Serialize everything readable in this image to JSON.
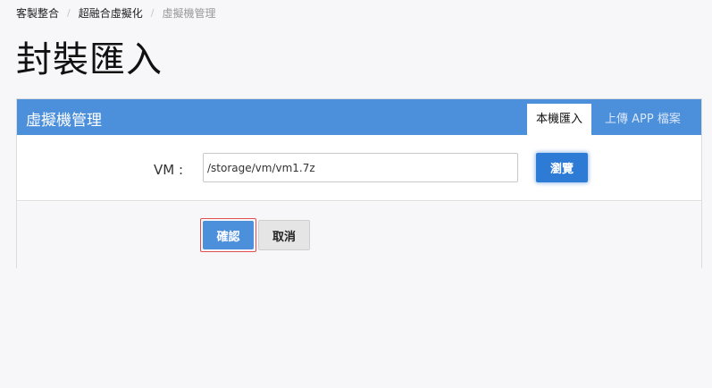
{
  "breadcrumb": [
    "客製整合",
    "超融合虛擬化",
    "虛擬機管理"
  ],
  "page_title": "封裝匯入",
  "panel": {
    "title": "虛擬機管理",
    "tabs": [
      {
        "label": "本機匯入",
        "active": true
      },
      {
        "label": "上傳 APP 檔案",
        "active": false
      }
    ]
  },
  "form": {
    "vm_label": "VM :",
    "vm_value": "/storage/vm/vm1.7z",
    "browse_label": "瀏覽"
  },
  "actions": {
    "confirm_label": "確認",
    "cancel_label": "取消"
  },
  "colors": {
    "header": "#4c8fdb",
    "primary": "#2e7bd6",
    "focus_outline": "#e05050"
  }
}
